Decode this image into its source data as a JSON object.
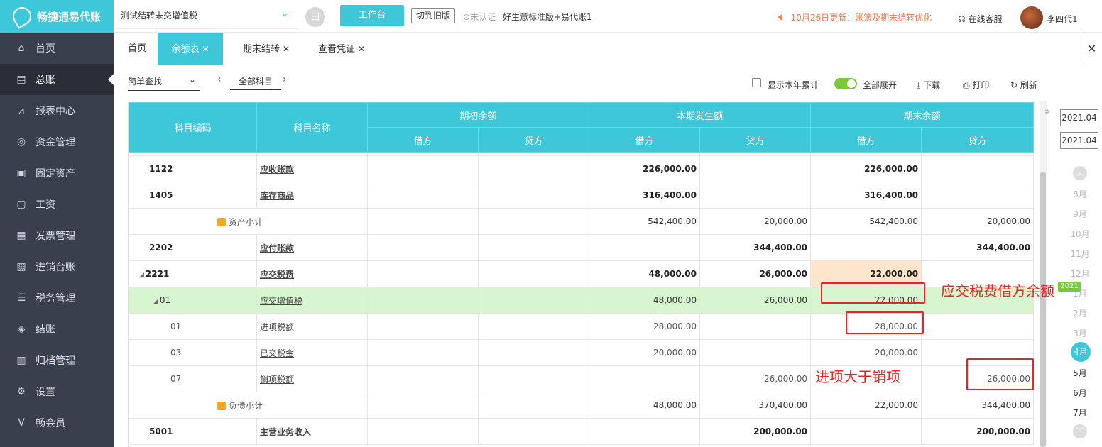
{
  "brand": {
    "name": "畅捷通易代账"
  },
  "sidebar": {
    "items": [
      {
        "label": "首页",
        "icon": "home-icon",
        "glyph": "⌂"
      },
      {
        "label": "总账",
        "icon": "ledger-icon",
        "glyph": "▤"
      },
      {
        "label": "报表中心",
        "icon": "chart-icon",
        "glyph": "⩘"
      },
      {
        "label": "资金管理",
        "icon": "wallet-icon",
        "glyph": "◎"
      },
      {
        "label": "固定资产",
        "icon": "asset-icon",
        "glyph": "▣"
      },
      {
        "label": "工资",
        "icon": "salary-icon",
        "glyph": "▢"
      },
      {
        "label": "发票管理",
        "icon": "invoice-icon",
        "glyph": "▦"
      },
      {
        "label": "进销台账",
        "icon": "inventory-icon",
        "glyph": "▧"
      },
      {
        "label": "税务管理",
        "icon": "tax-icon",
        "glyph": "☰"
      },
      {
        "label": "结账",
        "icon": "close-books-icon",
        "glyph": "◈"
      },
      {
        "label": "归档管理",
        "icon": "archive-icon",
        "glyph": "▥"
      },
      {
        "label": "设置",
        "icon": "gear-icon",
        "glyph": "⚙"
      },
      {
        "label": "畅会员",
        "icon": "vip-icon",
        "glyph": "V"
      }
    ]
  },
  "header": {
    "account": "测试结转未交增值税",
    "circle_glyph": "白",
    "workbench": "工作台",
    "old_version": "切到旧版",
    "cert": "未认证",
    "product": "好生意标准版+易代账1",
    "notice": "10月26日更新：账簿及期末结转优化",
    "service": "在线客服",
    "user": "李四代1"
  },
  "tabs": [
    {
      "label": "首页",
      "close": false
    },
    {
      "label": "余额表",
      "close": true,
      "active": true
    },
    {
      "label": "期末结转",
      "close": true
    },
    {
      "label": "查看凭证",
      "close": true
    }
  ],
  "toolbar": {
    "simple_search": "简单查找",
    "all_subjects": "全部科目",
    "show_year": "显示本年累计",
    "expand_all": "全部展开",
    "download": "下载",
    "print": "打印",
    "refresh": "刷新"
  },
  "table": {
    "headers": {
      "code": "科目编码",
      "name": "科目名称",
      "opening": "期初余额",
      "current": "本期发生额",
      "closing": "期末余额",
      "debit": "借方",
      "credit": "贷方"
    },
    "rows": [
      {
        "code": "1122",
        "name": "应收账款",
        "cur_d": "226,000.00",
        "cur_c": "",
        "end_d": "226,000.00",
        "end_c": "",
        "type": "bold"
      },
      {
        "code": "1405",
        "name": "库存商品",
        "cur_d": "316,400.00",
        "cur_c": "",
        "end_d": "316,400.00",
        "end_c": "",
        "type": "bold"
      },
      {
        "code": "",
        "name": "资产小计",
        "cur_d": "542,400.00",
        "cur_c": "20,000.00",
        "end_d": "542,400.00",
        "end_c": "20,000.00",
        "type": "subtotal"
      },
      {
        "code": "2202",
        "name": "应付账款",
        "cur_d": "",
        "cur_c": "344,400.00",
        "end_d": "",
        "end_c": "344,400.00",
        "type": "bold"
      },
      {
        "code": "2221",
        "name": "应交税费",
        "cur_d": "48,000.00",
        "cur_c": "26,000.00",
        "end_d": "22,000.00",
        "end_c": "",
        "type": "bold-tree"
      },
      {
        "code": "01",
        "name": "应交增值税",
        "cur_d": "48,000.00",
        "cur_c": "26,000.00",
        "end_d": "22,000.00",
        "end_c": "",
        "type": "sel"
      },
      {
        "code": "01",
        "name": "进项税额",
        "cur_d": "28,000.00",
        "cur_c": "",
        "end_d": "28,000.00",
        "end_c": "",
        "type": "leaf"
      },
      {
        "code": "03",
        "name": "已交税金",
        "cur_d": "20,000.00",
        "cur_c": "",
        "end_d": "20,000.00",
        "end_c": "",
        "type": "leaf"
      },
      {
        "code": "07",
        "name": "销项税额",
        "cur_d": "",
        "cur_c": "26,000.00",
        "end_d": "",
        "end_c": "26,000.00",
        "type": "leaf"
      },
      {
        "code": "",
        "name": "负债小计",
        "cur_d": "48,000.00",
        "cur_c": "370,400.00",
        "end_d": "22,000.00",
        "end_c": "344,400.00",
        "type": "subtotal"
      },
      {
        "code": "5001",
        "name": "主营业务收入",
        "cur_d": "",
        "cur_c": "200,000.00",
        "end_d": "",
        "end_c": "200,000.00",
        "type": "bold"
      }
    ]
  },
  "period": {
    "start": "2021.04",
    "end": "2021.04",
    "year_badge": "2021",
    "months": [
      "8月",
      "9月",
      "10月",
      "11月",
      "12月",
      "1月",
      "2月",
      "3月",
      "4月",
      "5月",
      "6月",
      "7月"
    ],
    "current": "4月"
  },
  "annotations": {
    "a1": "应交税费借方余额",
    "a2": "进项大于销项"
  },
  "colors": {
    "accent": "#3ec7d9",
    "sidebar": "#3a3f4d",
    "toggle": "#79c93b",
    "annotation": "#e22222",
    "highlight": "#fde6cc",
    "selected_row": "#d7f5cf"
  }
}
